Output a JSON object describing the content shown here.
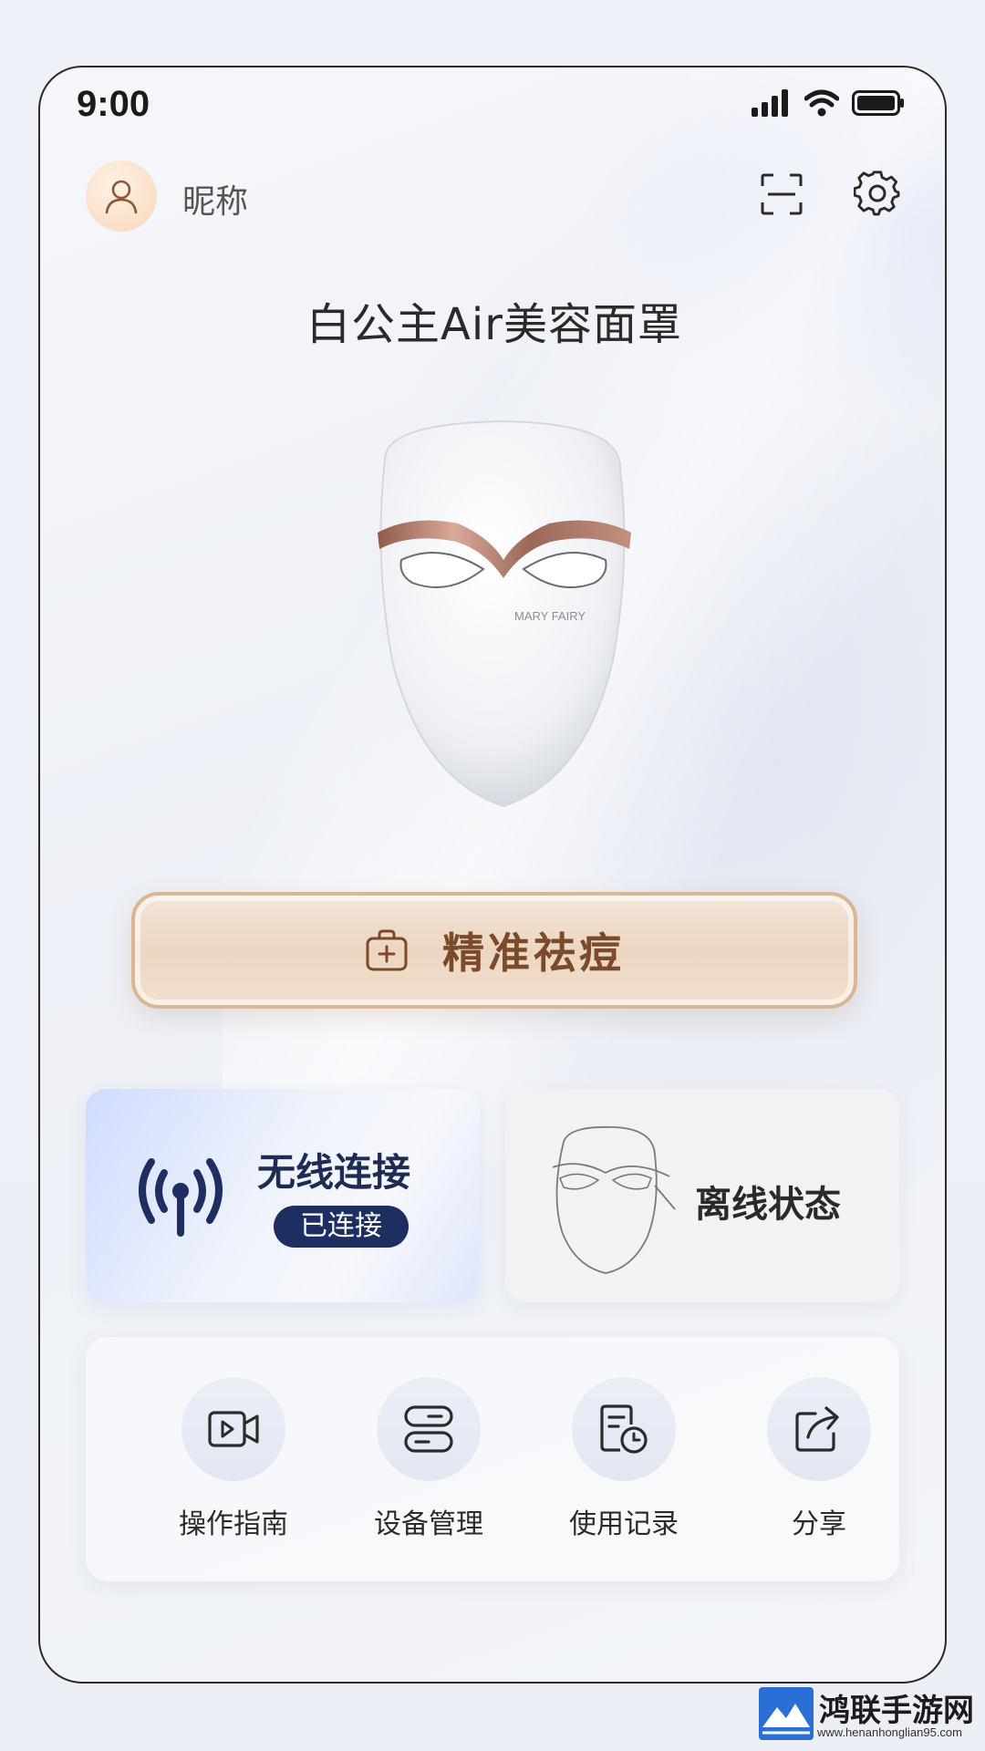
{
  "status_bar": {
    "time": "9:00"
  },
  "header": {
    "nickname": "昵称"
  },
  "device": {
    "title": "白公主Air美容面罩",
    "brand_on_mask": "MARY FAIRY"
  },
  "main_action": {
    "label": "精准祛痘"
  },
  "wireless_card": {
    "title": "无线连接",
    "status": "已连接"
  },
  "offline_card": {
    "label": "离线状态"
  },
  "shortcuts": [
    {
      "label": "操作指南",
      "icon": "video-guide-icon"
    },
    {
      "label": "设备管理",
      "icon": "device-manage-icon"
    },
    {
      "label": "使用记录",
      "icon": "usage-record-icon"
    },
    {
      "label": "分享",
      "icon": "share-icon"
    }
  ],
  "watermark": {
    "text": "鸿联手游网",
    "url": "www.henanhonglian95.com"
  },
  "colors": {
    "accent_navy": "#1f2e61",
    "gold_text": "#7a4a2a",
    "gold_border": "#d9b796"
  }
}
